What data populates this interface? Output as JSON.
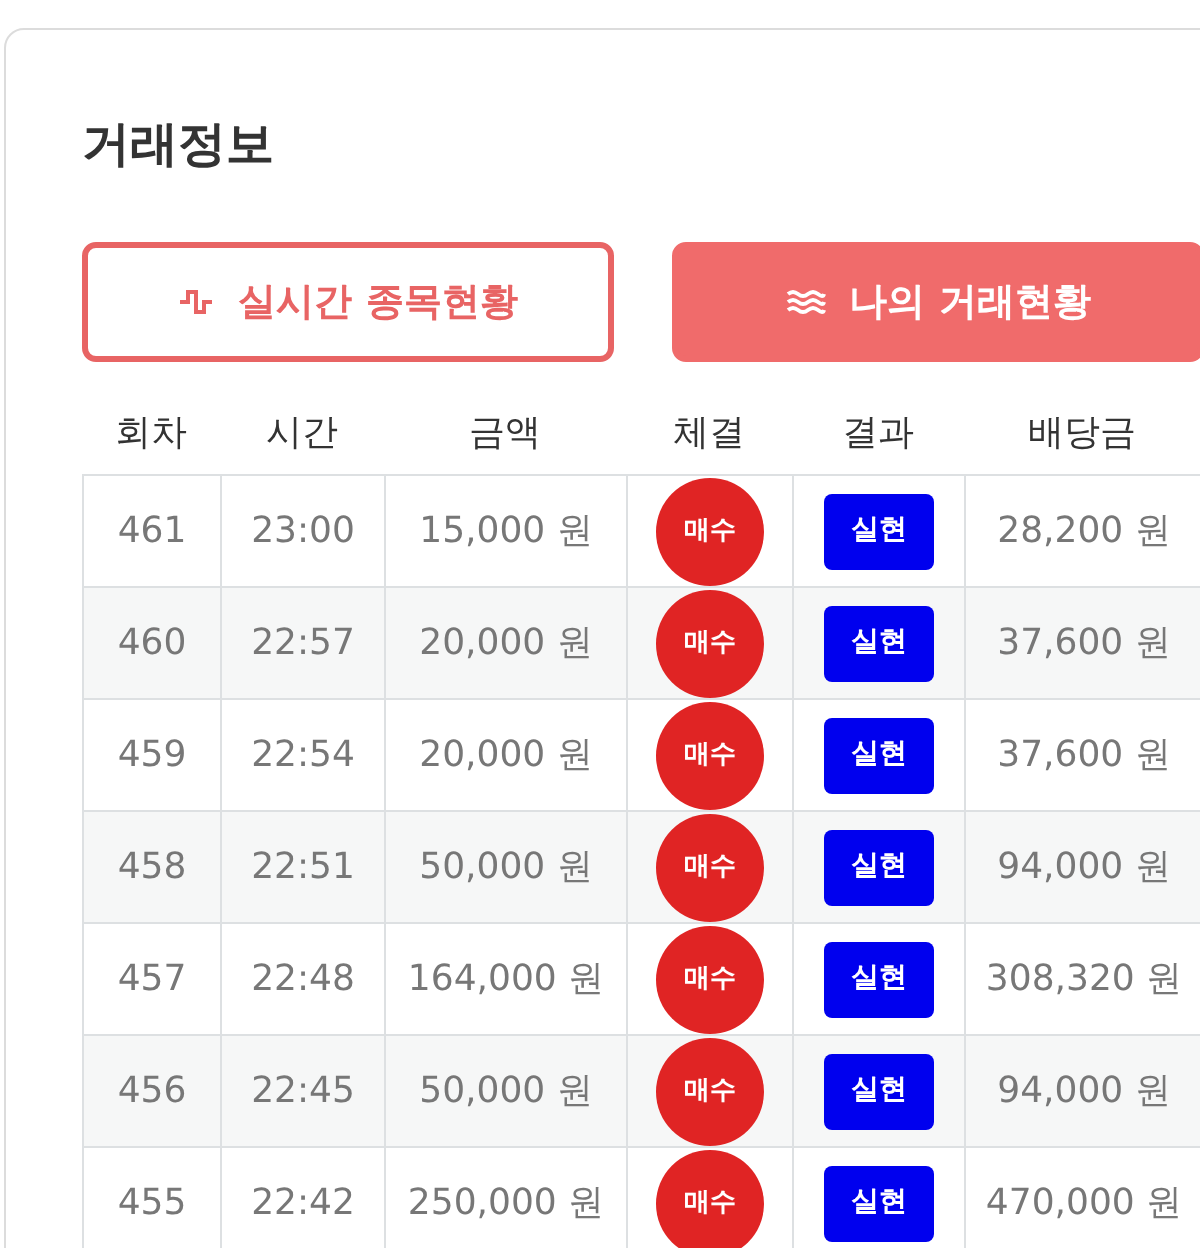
{
  "title": "거래정보",
  "tabs": [
    {
      "label": "실시간 종목현황",
      "kind": "pulse",
      "selected": false
    },
    {
      "label": "나의 거래현황",
      "kind": "waves",
      "selected": true
    }
  ],
  "table": {
    "columns": [
      "회차",
      "시간",
      "금액",
      "체결",
      "결과",
      "배당금"
    ],
    "rows": [
      {
        "round": "461",
        "time": "23:00",
        "amount": "15,000 원",
        "trade": "매수",
        "result": "실현",
        "payout": "28,200 원"
      },
      {
        "round": "460",
        "time": "22:57",
        "amount": "20,000 원",
        "trade": "매수",
        "result": "실현",
        "payout": "37,600 원"
      },
      {
        "round": "459",
        "time": "22:54",
        "amount": "20,000 원",
        "trade": "매수",
        "result": "실현",
        "payout": "37,600 원"
      },
      {
        "round": "458",
        "time": "22:51",
        "amount": "50,000 원",
        "trade": "매수",
        "result": "실현",
        "payout": "94,000 원"
      },
      {
        "round": "457",
        "time": "22:48",
        "amount": "164,000 원",
        "trade": "매수",
        "result": "실현",
        "payout": "308,320 원"
      },
      {
        "round": "456",
        "time": "22:45",
        "amount": "50,000 원",
        "trade": "매수",
        "result": "실현",
        "payout": "94,000 원"
      },
      {
        "round": "455",
        "time": "22:42",
        "amount": "250,000 원",
        "trade": "매수",
        "result": "실현",
        "payout": "470,000 원"
      }
    ]
  }
}
